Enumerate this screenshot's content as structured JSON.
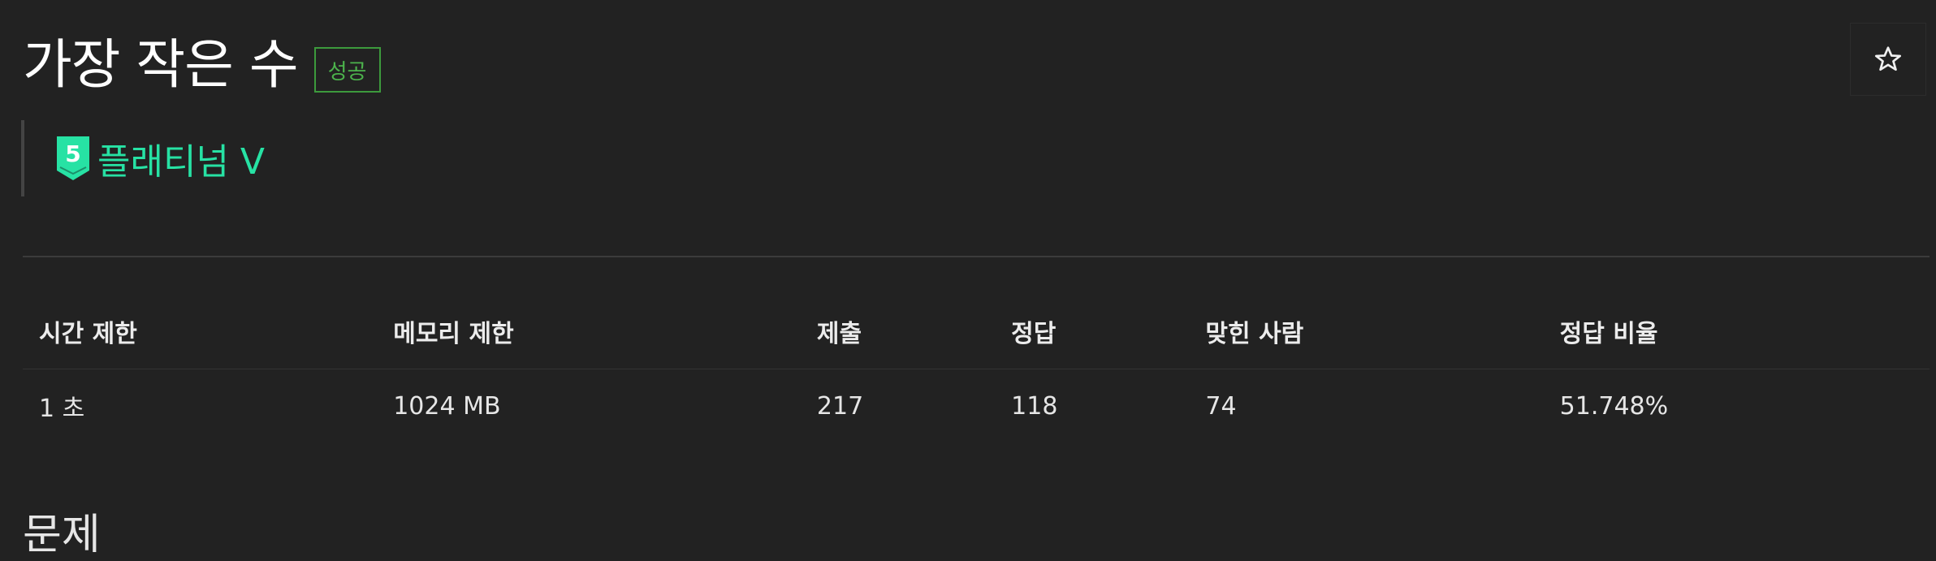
{
  "problem": {
    "title": "가장 작은 수",
    "result_badge": "성공",
    "star_icon": "star-outline-icon"
  },
  "tier": {
    "number": "5",
    "label": "플래티넘 V",
    "color": "#27e2a4",
    "icon": "tier-badge-icon"
  },
  "table": {
    "headers": [
      "시간 제한",
      "메모리 제한",
      "제출",
      "정답",
      "맞힌 사람",
      "정답 비율"
    ],
    "values": [
      "1 초",
      "1024 MB",
      "217",
      "118",
      "74",
      "51.748%"
    ]
  },
  "section": {
    "title": "문제"
  },
  "colors": {
    "background": "#222222",
    "success": "#4cb34c",
    "platinum": "#27e2a4"
  }
}
